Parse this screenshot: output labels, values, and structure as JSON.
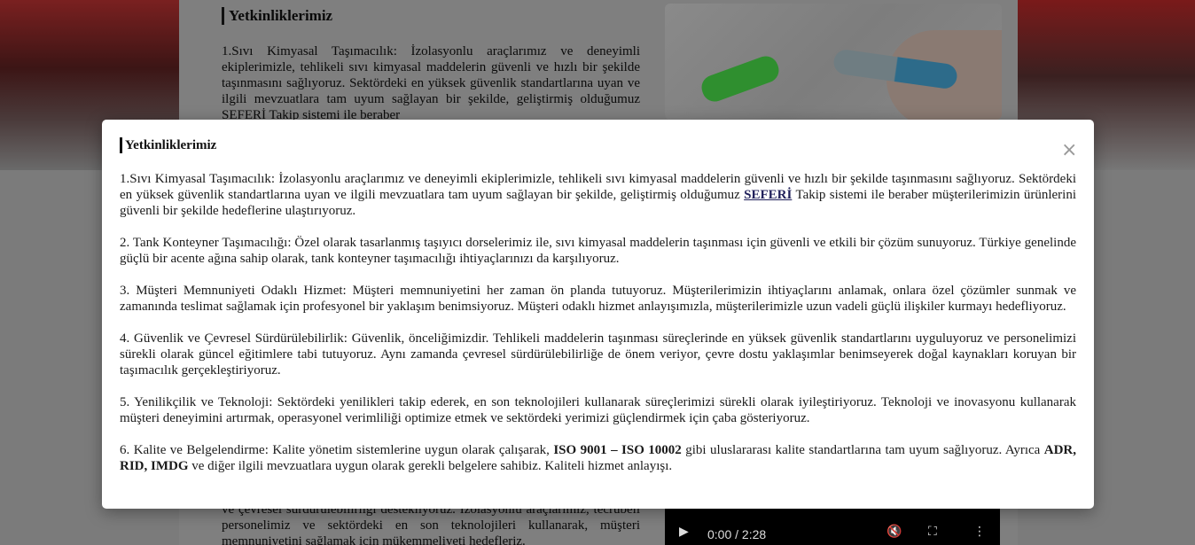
{
  "background": {
    "section_title": "Yetkinliklerimiz",
    "intro_lines": "1.Sıvı Kimyasal Taşımacılık: İzolasyonlu araçlarımız ve deneyimli ekiplerimizle, tehlikeli sıvı kimyasal maddelerin güvenli ve hızlı bir şekilde taşınmasını sağlıyoruz. Sektördeki en yüksek güvenlik standartlarına uyan ve ilgili mevzuatlara tam uyum sağlayan bir şekilde, geliştirmiş olduğumuz SEFERİ Takip sistemi ile beraber",
    "bottom_lines": "ve çevresel sürdürülebilirliği destekliyoruz. İzolasyonlu araçlarımız, tecrübeli personelimiz ve sektördeki en son teknolojileri kullanarak, müşteri memnuniyetini sağlamak için mükemmeliyeti hedefleriz.",
    "video": {
      "time": "0:00 / 2:28"
    }
  },
  "modal": {
    "title": "Yetkinliklerimiz",
    "close_symbol": "×",
    "p1_pre": "1.Sıvı Kimyasal Taşımacılık: İzolasyonlu araçlarımız ve deneyimli ekiplerimizle, tehlikeli sıvı kimyasal maddelerin güvenli ve hızlı bir şekilde taşınmasını sağlıyoruz. Sektördeki en yüksek güvenlik standartlarına uyan ve ilgili mevzuatlara tam uyum sağlayan bir şekilde, geliştirmiş olduğumuz ",
    "p1_link": "SEFERİ",
    "p1_post": " Takip sistemi ile beraber müşterilerimizin ürünlerini güvenli bir şekilde hedeflerine ulaştırıyoruz.",
    "p2": "2. Tank Konteyner Taşımacılığı: Özel olarak tasarlanmış taşıyıcı dorselerimiz ile, sıvı kimyasal maddelerin taşınması için güvenli ve etkili bir çözüm sunuyoruz. Türkiye genelinde güçlü bir acente ağına sahip olarak, tank konteyner taşımacılığı ihtiyaçlarınızı da karşılıyoruz.",
    "p3": "3. Müşteri Memnuniyeti Odaklı Hizmet: Müşteri memnuniyetini her zaman ön planda tutuyoruz. Müşterilerimizin ihtiyaçlarını anlamak, onlara özel çözümler sunmak ve zamanında teslimat sağlamak için profesyonel bir yaklaşım benimsiyoruz. Müşteri odaklı hizmet anlayışımızla, müşterilerimizle uzun vadeli güçlü ilişkiler kurmayı hedefliyoruz.",
    "p4": "4. Güvenlik ve Çevresel Sürdürülebilirlik: Güvenlik, önceliğimizdir. Tehlikeli maddelerin taşınması süreçlerinde en yüksek güvenlik standartlarını uyguluyoruz ve personelimizi sürekli olarak güncel eğitimlere tabi tutuyoruz. Aynı zamanda çevresel sürdürülebilirliğe de önem veriyor, çevre dostu yaklaşımlar benimseyerek doğal kaynakları koruyan bir taşımacılık gerçekleştiriyoruz.",
    "p5": "5. Yenilikçilik ve Teknoloji: Sektördeki yenilikleri takip ederek, en son teknolojileri kullanarak süreçlerimizi sürekli olarak iyileştiriyoruz. Teknoloji ve inovasyonu kullanarak müşteri deneyimini artırmak, operasyonel verimliliği optimize etmek ve sektördeki yerimizi güçlendirmek için çaba gösteriyoruz.",
    "p6_pre": "6. Kalite ve Belgelendirme: Kalite yönetim sistemlerine uygun olarak çalışarak, ",
    "p6_bold1": "ISO 9001 – ISO 10002",
    "p6_mid": " gibi uluslararası kalite standartlarına tam uyum sağlıyoruz. Ayrıca ",
    "p6_bold2": "ADR, RID, IMDG",
    "p6_post": " ve diğer ilgili mevzuatlara uygun olarak gerekli belgelere sahibiz. Kaliteli hizmet anlayışı."
  }
}
